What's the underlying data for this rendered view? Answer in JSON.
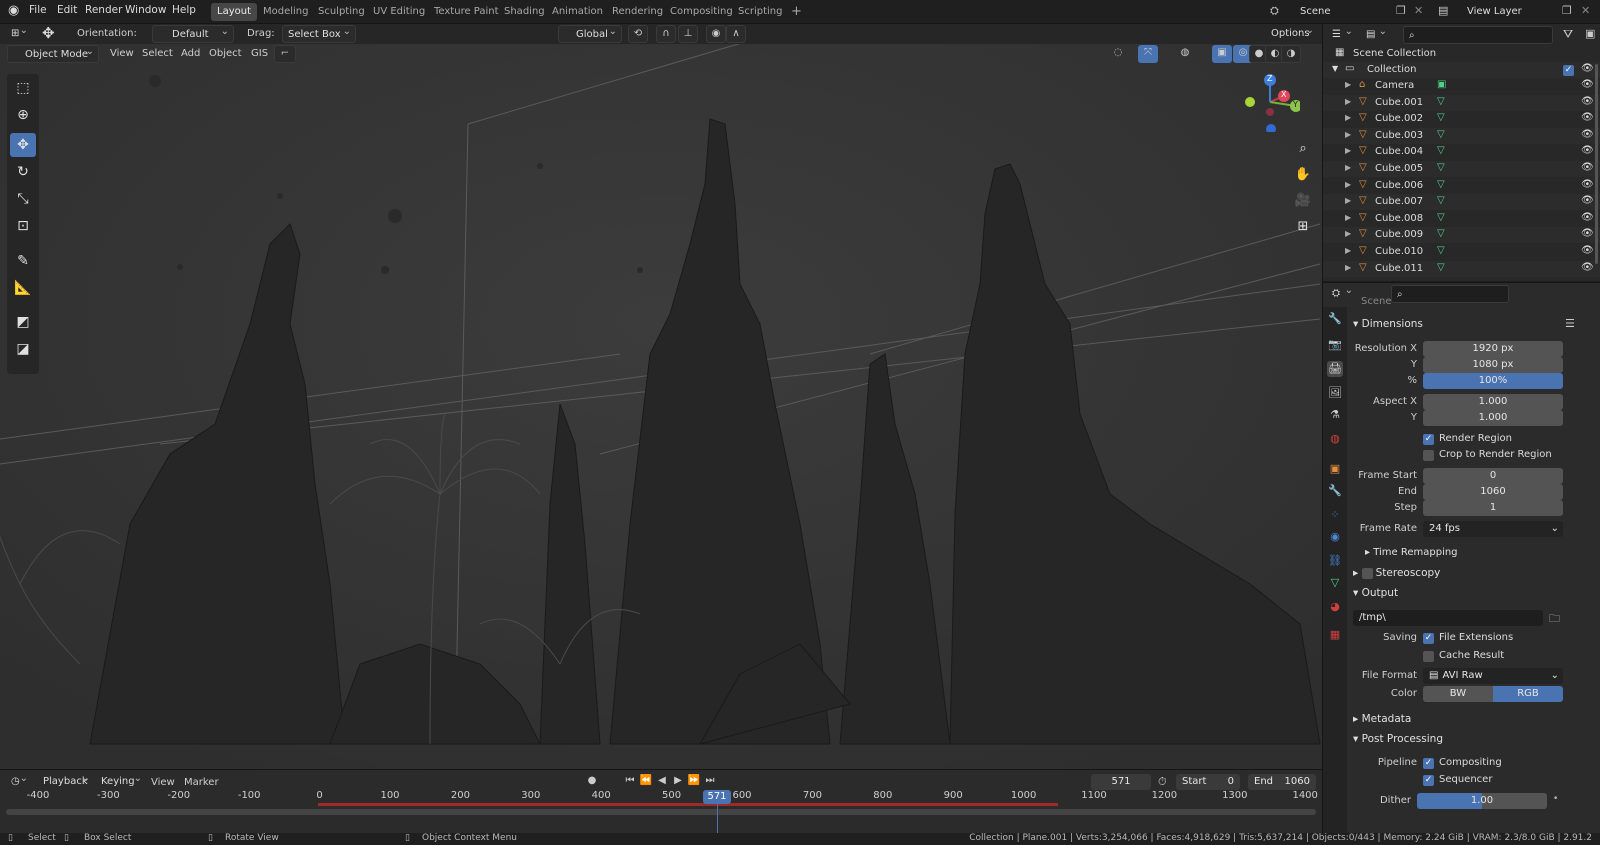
{
  "topbar": {
    "menus": [
      "File",
      "Edit",
      "Render",
      "Window",
      "Help"
    ],
    "workspaces": [
      {
        "label": "Layout",
        "active": true
      },
      {
        "label": "Modeling",
        "active": false
      },
      {
        "label": "Sculpting",
        "active": false
      },
      {
        "label": "UV Editing",
        "active": false
      },
      {
        "label": "Texture Paint",
        "active": false
      },
      {
        "label": "Shading",
        "active": false
      },
      {
        "label": "Animation",
        "active": false
      },
      {
        "label": "Rendering",
        "active": false
      },
      {
        "label": "Compositing",
        "active": false
      },
      {
        "label": "Scripting",
        "active": false
      }
    ],
    "add_tab": "+",
    "scene": "Scene",
    "view_layer": "View Layer"
  },
  "viewport_header": {
    "orientation_label": "Orientation:",
    "orientation_value": "Default",
    "drag_label": "Drag:",
    "drag_value": "Select Box",
    "transform_orientation": "Global",
    "options": "Options",
    "mode": "Object Mode",
    "menus": [
      "View",
      "Select",
      "Add",
      "Object",
      "GIS"
    ]
  },
  "gizmo": {
    "x": "X",
    "y": "Y",
    "z": "Z"
  },
  "outliner": {
    "root": "Scene Collection",
    "collection": "Collection",
    "items": [
      "Camera",
      "Cube.001",
      "Cube.002",
      "Cube.003",
      "Cube.004",
      "Cube.005",
      "Cube.006",
      "Cube.007",
      "Cube.008",
      "Cube.009",
      "Cube.010",
      "Cube.011"
    ]
  },
  "properties": {
    "context": "Scene",
    "dimensions": {
      "title": "Dimensions",
      "res_x_label": "Resolution X",
      "res_x": "1920 px",
      "res_y_label": "Y",
      "res_y": "1080 px",
      "pct_label": "%",
      "pct": "100%",
      "aspect_x_label": "Aspect X",
      "aspect_x": "1.000",
      "aspect_y_label": "Y",
      "aspect_y": "1.000",
      "render_region": "Render Region",
      "crop": "Crop to Render Region",
      "frame_start_label": "Frame Start",
      "frame_start": "0",
      "end_label": "End",
      "end": "1060",
      "step_label": "Step",
      "step": "1",
      "frame_rate_label": "Frame Rate",
      "frame_rate": "24 fps",
      "time_remap": "Time Remapping"
    },
    "stereoscopy": "Stereoscopy",
    "output": {
      "title": "Output",
      "path": "/tmp\\",
      "saving_label": "Saving",
      "file_ext": "File Extensions",
      "cache": "Cache Result",
      "format_label": "File Format",
      "format": "AVI Raw",
      "color_label": "Color",
      "bw": "BW",
      "rgb": "RGB"
    },
    "metadata": "Metadata",
    "post": {
      "title": "Post Processing",
      "pipeline_label": "Pipeline",
      "compositing": "Compositing",
      "sequencer": "Sequencer",
      "dither_label": "Dither",
      "dither": "1.00"
    }
  },
  "timeline": {
    "menus": [
      "Playback",
      "Keying",
      "View",
      "Marker"
    ],
    "current_frame": "571",
    "start_label": "Start",
    "start": "0",
    "end_label": "End",
    "end": "1060",
    "ticks": [
      "-400",
      "-300",
      "-200",
      "-100",
      "0",
      "100",
      "200",
      "300",
      "400",
      "500",
      "600",
      "700",
      "800",
      "900",
      "1000",
      "1100",
      "1200",
      "1300",
      "1400"
    ],
    "playhead": "571"
  },
  "statusbar": {
    "select": "Select",
    "box_select": "Box Select",
    "rotate": "Rotate View",
    "context_menu": "Object Context Menu",
    "stats": "Collection | Plane.001 | Verts:3,254,066 | Faces:4,918,629 | Tris:5,637,214 | Objects:0/443 | Memory: 2.24 GiB | VRAM: 2.3/8.0 GiB | 2.91.2"
  },
  "colors": {
    "accent": "#4a73b2",
    "timeline_range": "#a02a2a",
    "mesh_icon": "#e08f3e",
    "vert_icon": "#4fd18b"
  }
}
